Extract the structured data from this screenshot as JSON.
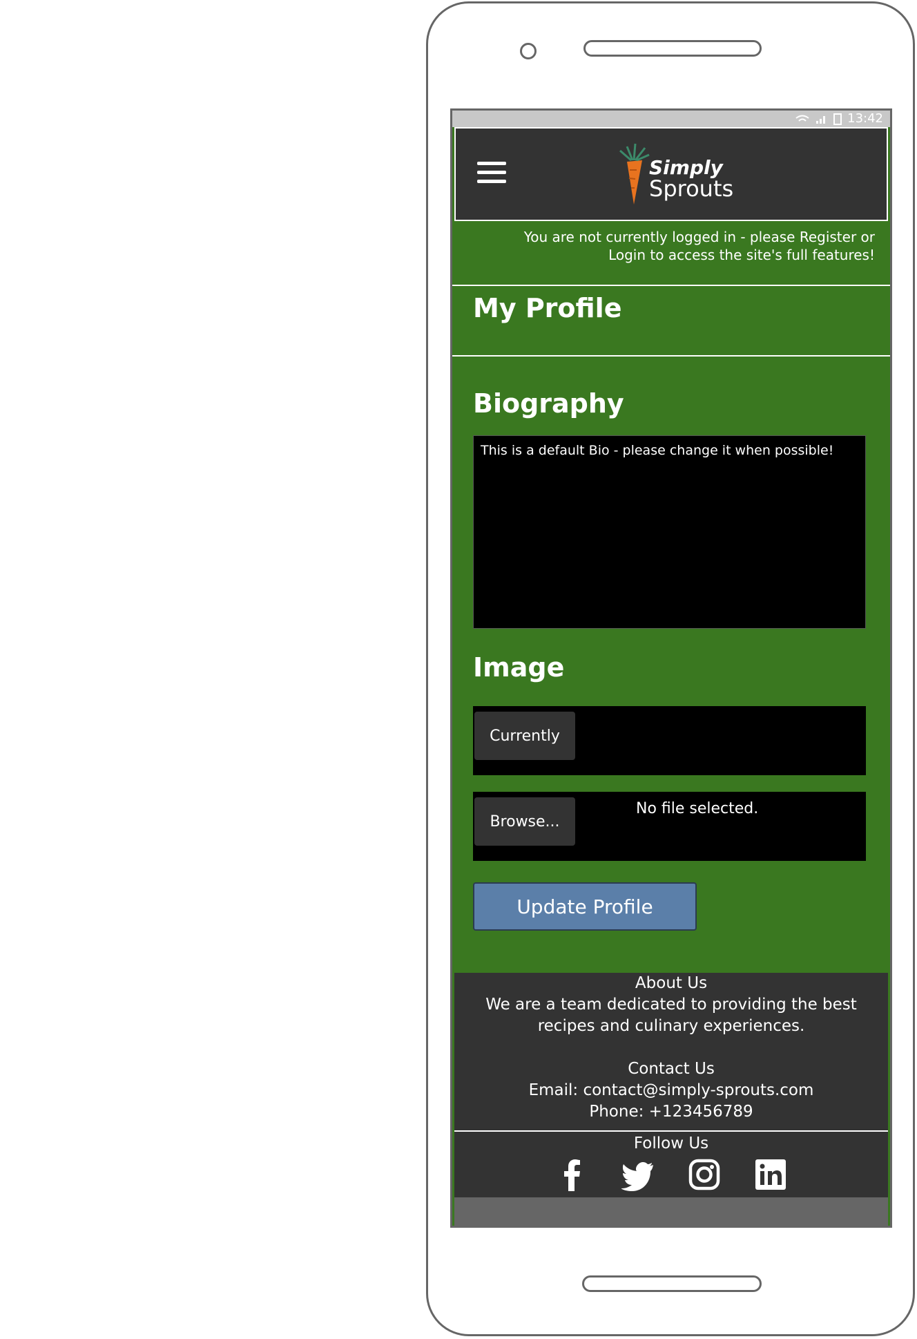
{
  "statusbar": {
    "time": "13:42"
  },
  "header": {
    "menu_icon": "hamburger-icon",
    "logo_line1": "Simply",
    "logo_line2": "Sprouts",
    "logo_icon": "carrot-icon"
  },
  "notice": {
    "text": "You are not currently logged in - please Register or Login to access the site's full features!"
  },
  "profile": {
    "title": "My Profile"
  },
  "biography": {
    "title": "Biography",
    "value": "This is a default Bio - please change it when possible!"
  },
  "image": {
    "title": "Image",
    "currently_label": "Currently",
    "browse_label": "Browse...",
    "file_status": "No file selected."
  },
  "update_button": "Update Profile",
  "footer": {
    "about_title": "About Us",
    "about_text": "We are a team dedicated to providing the best recipes and culinary experiences.",
    "contact_title": "Contact Us",
    "email": "Email: contact@simply-sprouts.com",
    "phone": "Phone: +123456789",
    "follow_title": "Follow Us",
    "social_icons": [
      "facebook-icon",
      "twitter-icon",
      "instagram-icon",
      "linkedin-icon"
    ]
  },
  "colors": {
    "page_green": "#3a7820",
    "header_dark": "#333333",
    "button_blue": "#5b7fa9",
    "input_black": "#000000"
  }
}
